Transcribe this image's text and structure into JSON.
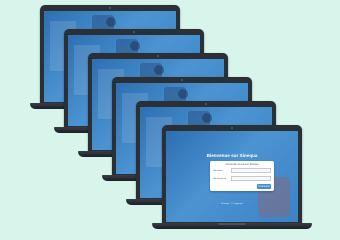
{
  "colors": {
    "background": "#d7f5ea",
    "laptop_body": "#2b2f36",
    "screen_blue": "#3f83c8",
    "primary_button": "#3f8fd6"
  },
  "login": {
    "welcome_title": "Bienvenue sur Sinequa",
    "header": "Connexion au serveur Sinequa",
    "username_label": "Utilisateur",
    "username_value": "",
    "password_label": "Mot de passe",
    "password_value": "",
    "submit_label": "Connexion",
    "footer": "Sinequa · © Copyright"
  }
}
